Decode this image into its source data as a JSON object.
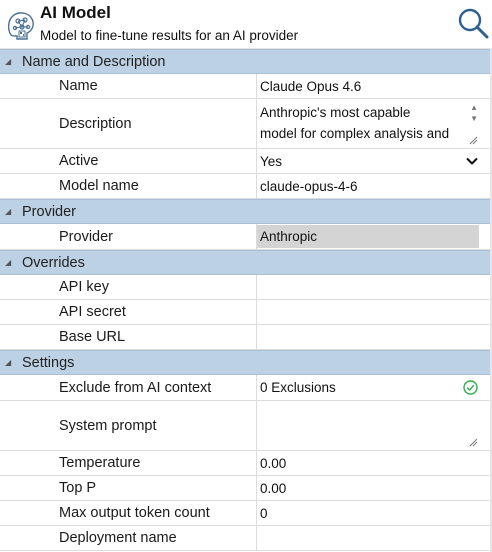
{
  "header": {
    "title": "AI Model",
    "subtitle": "Model to fine-tune results for an AI provider",
    "logo_icon": "ai-brain-icon",
    "search_icon": "search-icon"
  },
  "sections": {
    "name_desc": "Name and Description",
    "provider": "Provider",
    "overrides": "Overrides",
    "settings": "Settings"
  },
  "fields": {
    "name": {
      "label": "Name",
      "value": "Claude Opus 4.6"
    },
    "description": {
      "label": "Description",
      "line1": "Anthropic's most capable",
      "line2": "model for complex analysis and"
    },
    "active": {
      "label": "Active",
      "value": "Yes"
    },
    "model_name": {
      "label": "Model name",
      "value": "claude-opus-4-6"
    },
    "provider": {
      "label": "Provider",
      "value": "Anthropic"
    },
    "api_key": {
      "label": "API key",
      "value": ""
    },
    "api_secret": {
      "label": "API secret",
      "value": ""
    },
    "base_url": {
      "label": "Base URL",
      "value": ""
    },
    "exclude": {
      "label": "Exclude from AI context",
      "value": "0 Exclusions"
    },
    "system_prompt": {
      "label": "System prompt",
      "value": ""
    },
    "temperature": {
      "label": "Temperature",
      "value": "0.00"
    },
    "top_p": {
      "label": "Top P",
      "value": "0.00"
    },
    "max_tokens": {
      "label": "Max output token count",
      "value": "0"
    },
    "deployment": {
      "label": "Deployment name",
      "value": ""
    }
  },
  "colors": {
    "section_bg": "#bcd1e4",
    "readonly_bg": "#d4d4d4",
    "check_green": "#2fae4a"
  }
}
